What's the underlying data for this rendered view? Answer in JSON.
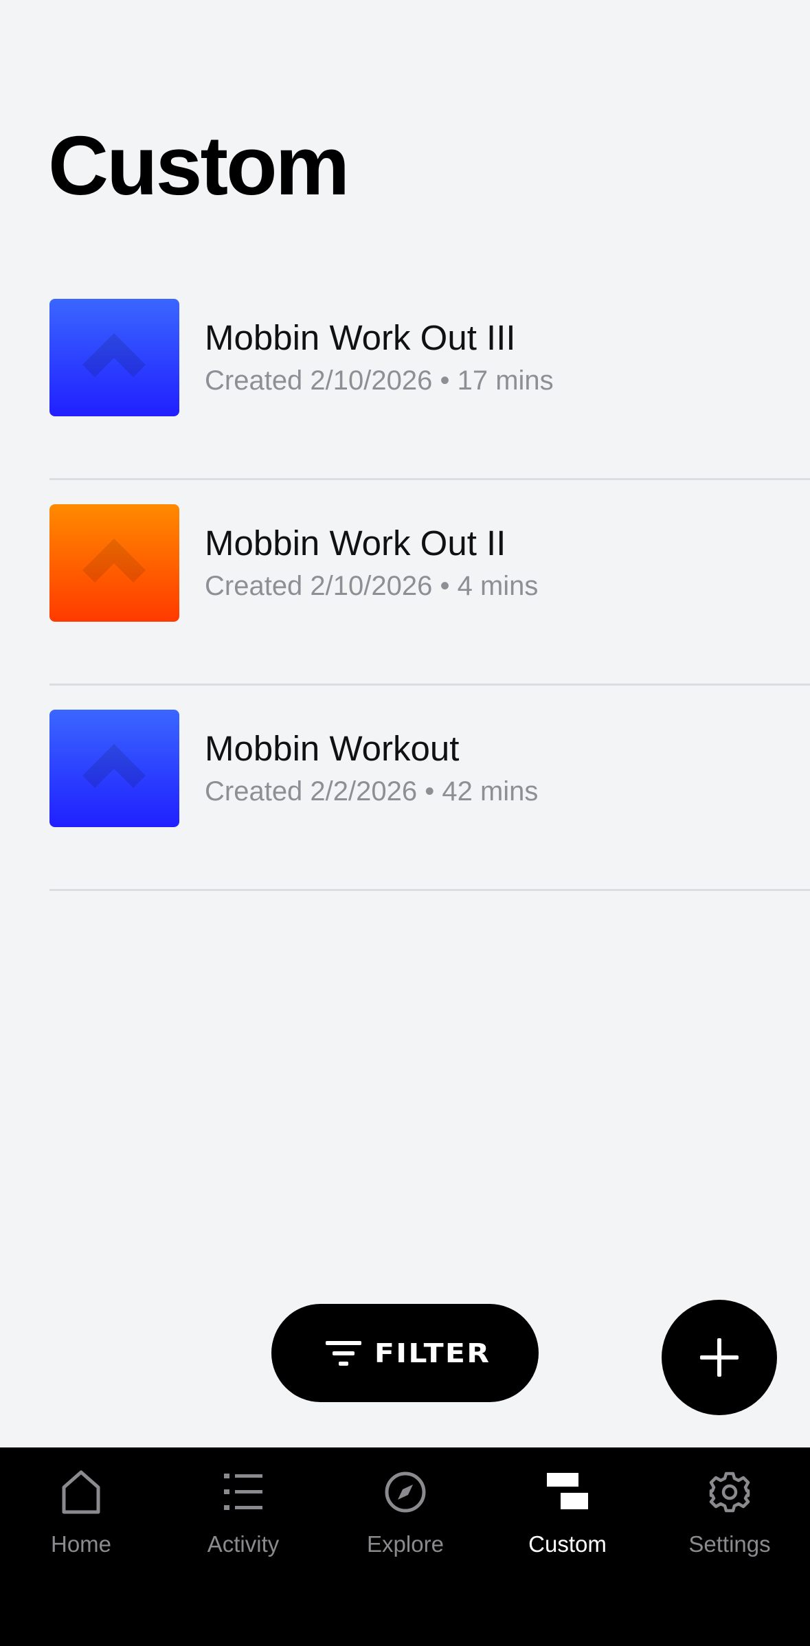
{
  "header": {
    "title": "Custom"
  },
  "workouts": [
    {
      "title": "Mobbin Work Out III",
      "subtitle": "Created 2/10/2026 • 17 mins",
      "color_top": "#3a66ff",
      "color_bottom": "#2020ff"
    },
    {
      "title": "Mobbin Work Out II",
      "subtitle": "Created 2/10/2026 • 4 mins",
      "color_top": "#ff8a00",
      "color_bottom": "#ff3a00"
    },
    {
      "title": "Mobbin Workout",
      "subtitle": "Created 2/2/2026 • 42 mins",
      "color_top": "#3a66ff",
      "color_bottom": "#2020ff"
    }
  ],
  "actions": {
    "filter_label": "FILTER",
    "filter_icon": "filter-lines-icon",
    "add_icon": "plus-icon"
  },
  "tabbar": {
    "active": "Custom",
    "items": [
      {
        "label": "Home",
        "icon": "home-icon"
      },
      {
        "label": "Activity",
        "icon": "list-icon"
      },
      {
        "label": "Explore",
        "icon": "compass-icon"
      },
      {
        "label": "Custom",
        "icon": "custom-blocks-icon"
      },
      {
        "label": "Settings",
        "icon": "gear-icon"
      }
    ]
  },
  "colors": {
    "background": "#f3f4f6",
    "accent_dark": "#000000",
    "muted_text": "#8e8f94",
    "tab_inactive": "#8b8b8f",
    "tab_active": "#ffffff"
  }
}
